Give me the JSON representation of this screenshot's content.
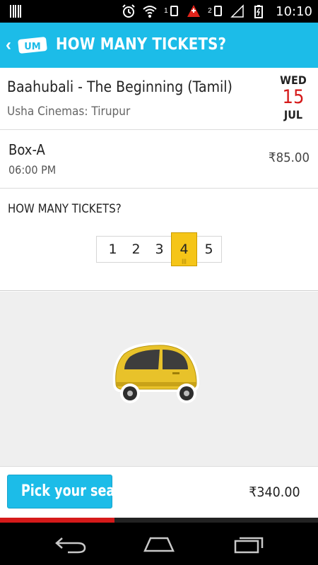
{
  "status_bar": {
    "time": "10:10",
    "sim1": "1",
    "sim2": "2"
  },
  "app_bar": {
    "title": "HOW MANY TICKETS?",
    "logo_text": "UM"
  },
  "movie": {
    "title": "Baahubali - The Beginning (Tamil)",
    "venue": "Usha Cinemas: Tirupur",
    "day": "WED",
    "date": "15",
    "month": "JUL"
  },
  "seat_class": {
    "name": "Box-A",
    "time": "06:00 PM",
    "price": "₹85.00"
  },
  "ticket_count": {
    "label": "HOW MANY TICKETS?",
    "options": [
      "1",
      "2",
      "3",
      "4",
      "5"
    ],
    "selected": "4",
    "selected_marker": "|||"
  },
  "vehicle": {
    "icon": "car-icon",
    "color": "#e8c22a"
  },
  "bottom": {
    "button_label": "Pick your seats",
    "total": "₹340.00"
  },
  "progress": {
    "fraction": 0.36
  },
  "colors": {
    "accent": "#1cbce8",
    "date_red": "#d51a1a",
    "selected": "#f5c518"
  }
}
